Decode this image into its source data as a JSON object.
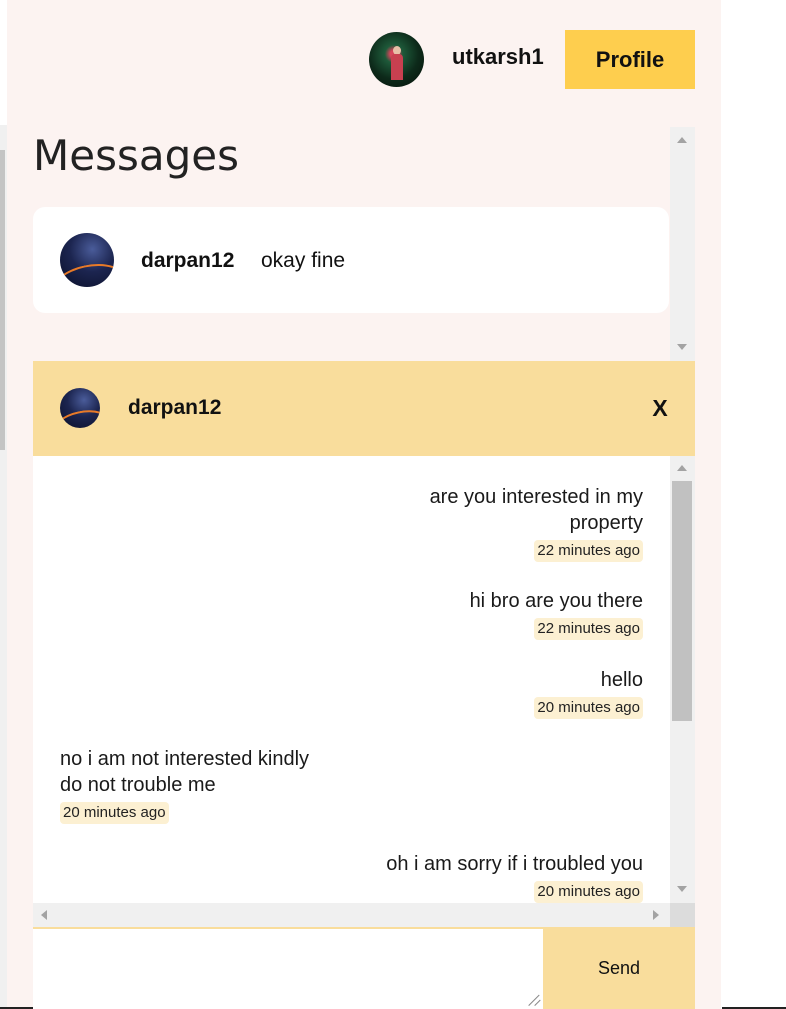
{
  "header": {
    "username": "utkarsh1",
    "profile_label": "Profile"
  },
  "messages_panel": {
    "title": "Messages",
    "conversations": [
      {
        "name": "darpan12",
        "preview": "okay fine"
      }
    ]
  },
  "chat": {
    "contact_name": "darpan12",
    "close_label": "X",
    "messages": [
      {
        "side": "right",
        "text_line1": "are you interested in my",
        "text_line2": "property",
        "time": "22 minutes ago"
      },
      {
        "side": "right",
        "text": "hi bro are you there",
        "time": "22 minutes ago"
      },
      {
        "side": "right",
        "text": "hello",
        "time": "20 minutes ago"
      },
      {
        "side": "left",
        "text_line1": "no i am not interested kindly",
        "text_line2": "do not trouble me",
        "time": "20 minutes ago"
      },
      {
        "side": "right",
        "text": "oh i am sorry if i troubled you",
        "time": "20 minutes ago"
      }
    ],
    "input_value": "",
    "send_label": "Send"
  },
  "colors": {
    "page_background": "#fcf3f1",
    "accent_yellow": "#fece4e",
    "chat_header": "#f9dd9c",
    "timestamp_badge": "#fcf0d2"
  },
  "icons": [
    "user-avatar",
    "contact-avatar",
    "close-icon",
    "resize-grip-icon"
  ]
}
